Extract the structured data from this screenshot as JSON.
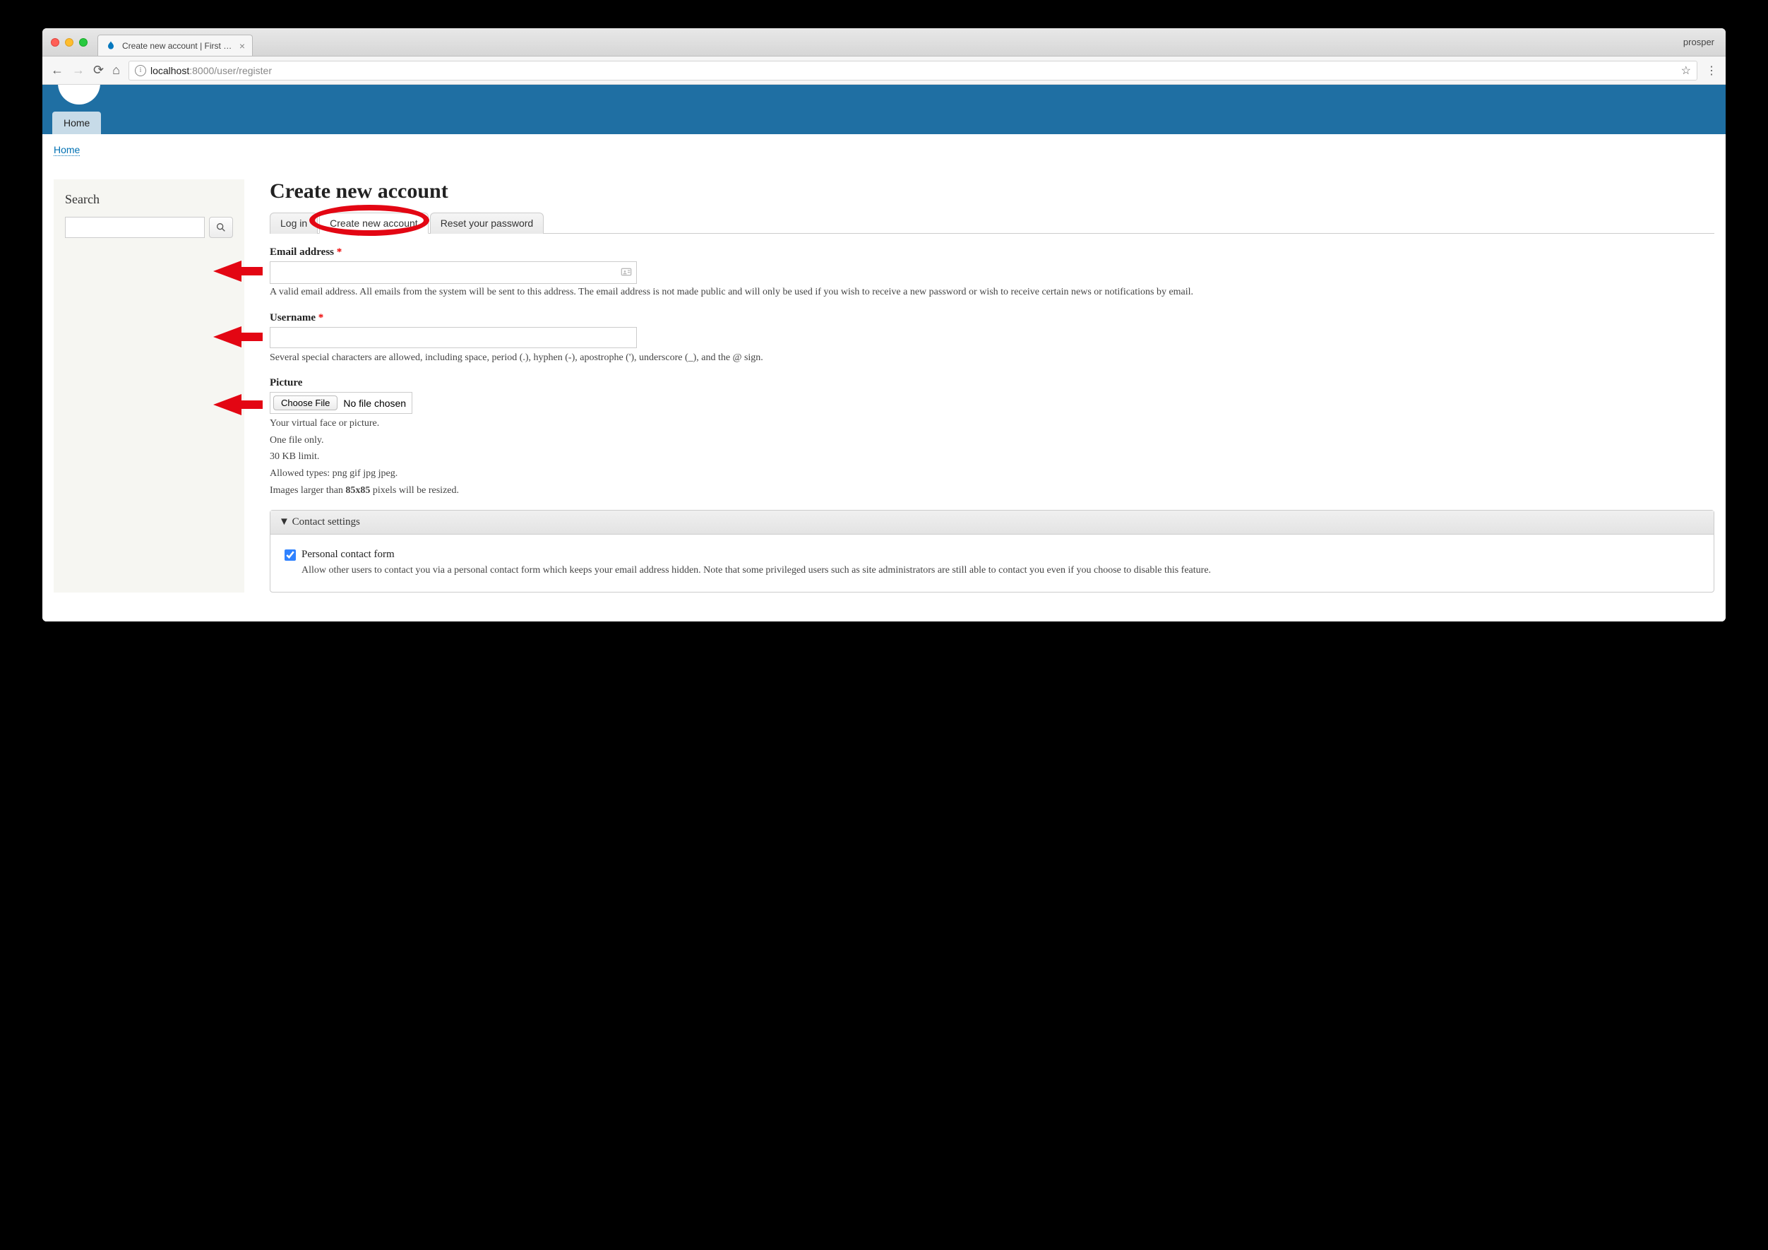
{
  "browser": {
    "profile": "prosper",
    "tab_title": "Create new account | First Dru",
    "address_host": "localhost",
    "address_port": ":8000",
    "address_path": "/user/register"
  },
  "nav": {
    "home_item": "Home",
    "breadcrumb_home": "Home"
  },
  "sidebar": {
    "search_title": "Search"
  },
  "page": {
    "title": "Create new account",
    "tabs": {
      "login": "Log in",
      "create": "Create new account",
      "reset": "Reset your password"
    }
  },
  "form": {
    "email": {
      "label": "Email address",
      "help": "A valid email address. All emails from the system will be sent to this address. The email address is not made public and will only be used if you wish to receive a new password or wish to receive certain news or notifications by email."
    },
    "username": {
      "label": "Username",
      "help": "Several special characters are allowed, including space, period (.), hyphen (-), apostrophe ('), underscore (_), and the @ sign."
    },
    "picture": {
      "label": "Picture",
      "choose_btn": "Choose File",
      "no_file": "No file chosen",
      "help_1": "Your virtual face or picture.",
      "help_2": "One file only.",
      "help_3": "30 KB limit.",
      "help_4": "Allowed types: png gif jpg jpeg.",
      "help_5a": "Images larger than ",
      "help_5b": "85x85",
      "help_5c": " pixels will be resized."
    },
    "contact": {
      "summary": "Contact settings",
      "checkbox_label": "Personal contact form",
      "help": "Allow other users to contact you via a personal contact form which keeps your email address hidden. Note that some privileged users such as site administrators are still able to contact you even if you choose to disable this feature."
    }
  }
}
